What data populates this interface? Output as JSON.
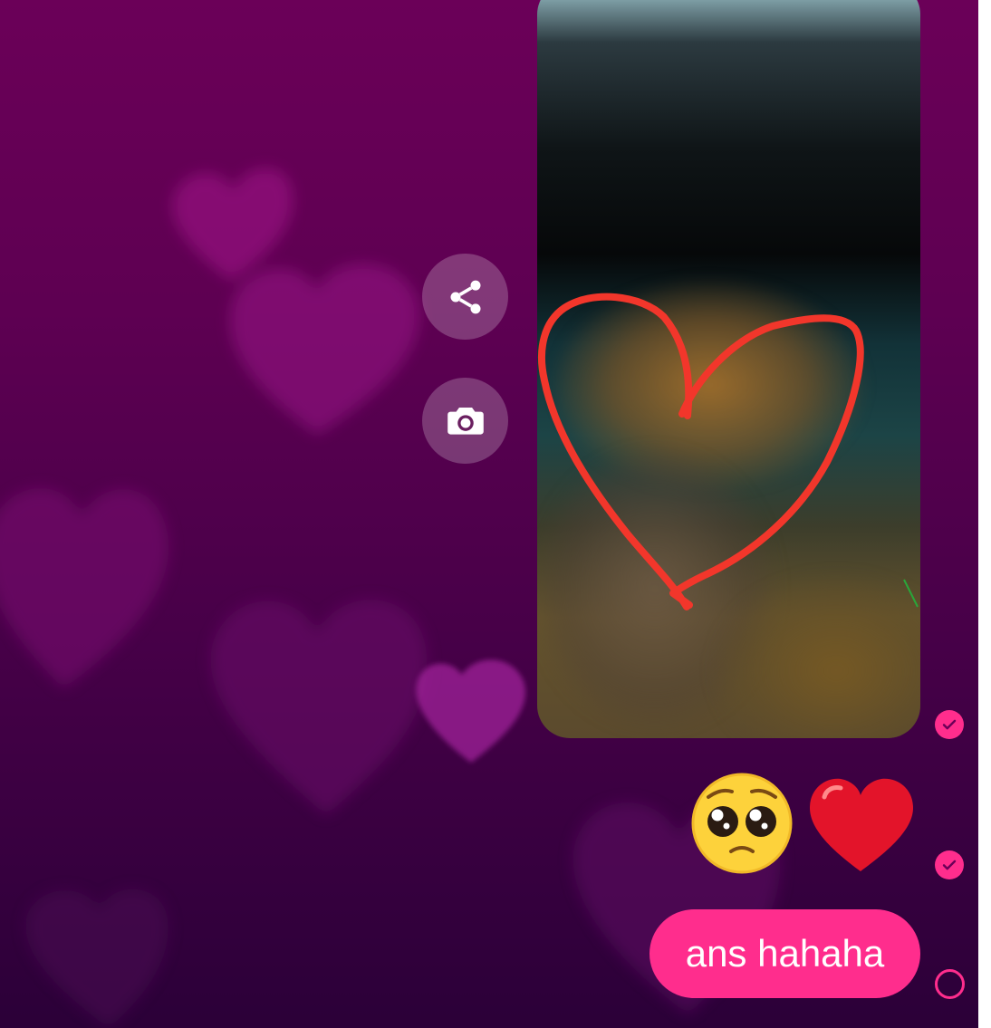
{
  "chat": {
    "actions": {
      "share_icon": "share-icon",
      "camera_icon": "camera-icon"
    },
    "messages": [
      {
        "type": "photo",
        "status": "read"
      },
      {
        "type": "emoji",
        "content": "🥺❤️",
        "status": "read"
      },
      {
        "type": "text",
        "content": "ans hahaha",
        "status": "sent"
      }
    ]
  },
  "colors": {
    "bubble": "#ff2d8d",
    "status": "#ff2d8d",
    "background_top": "#6b0058",
    "background_bottom": "#2b0038",
    "drawing_stroke": "#f2362b"
  }
}
